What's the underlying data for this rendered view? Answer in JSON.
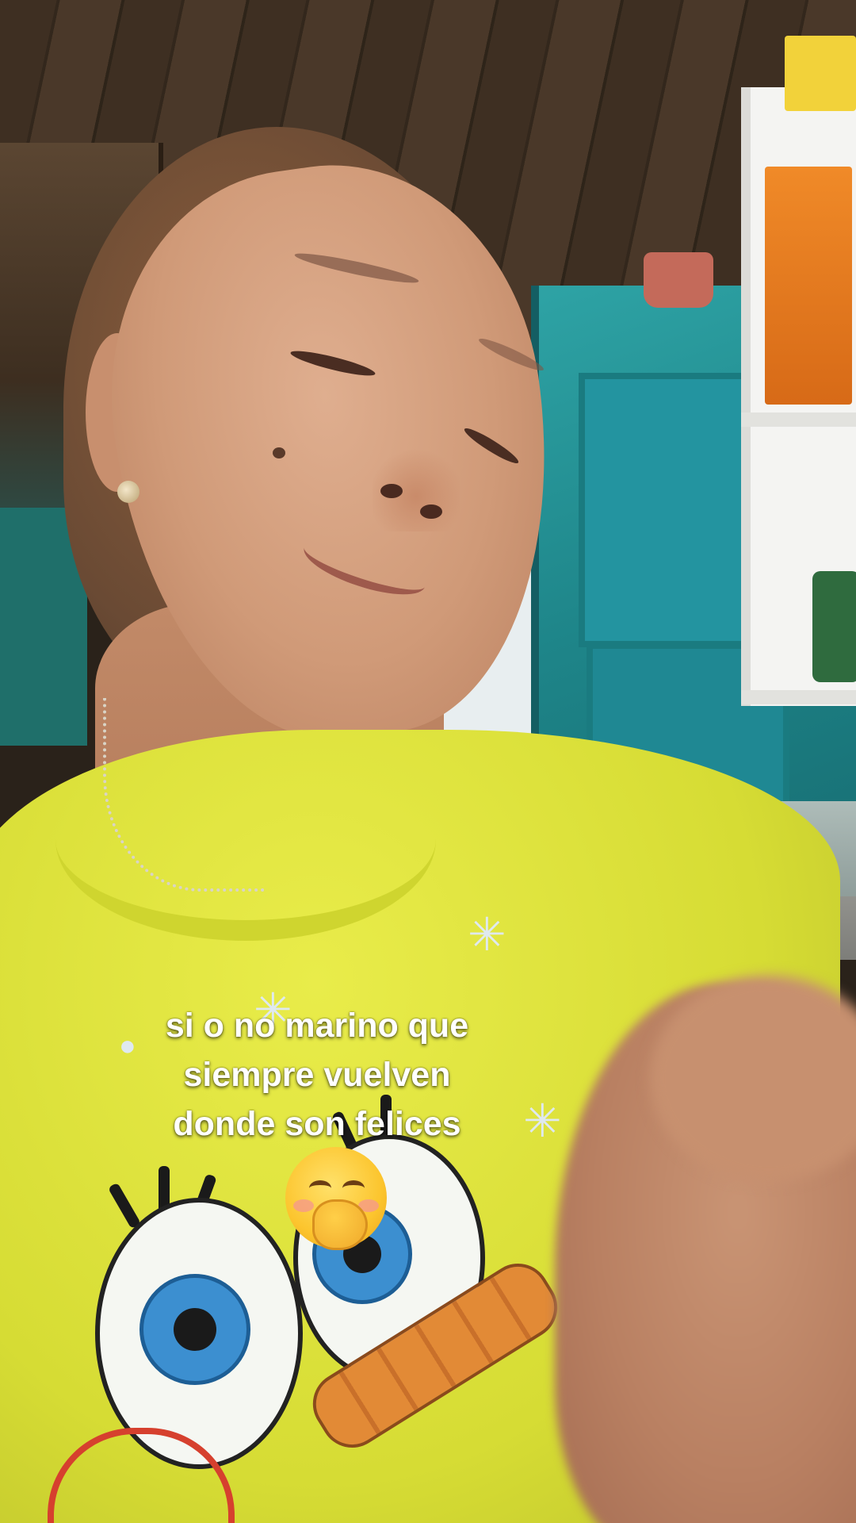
{
  "caption": {
    "lines": [
      "si o no marino que",
      "siempre  vuelven",
      "donde  son felices"
    ],
    "emoji": "face-with-hand-over-mouth"
  },
  "colors": {
    "caption_text": "#ffffff",
    "shirt": "#dfe43e",
    "cabinet": "#1f8a8f"
  }
}
